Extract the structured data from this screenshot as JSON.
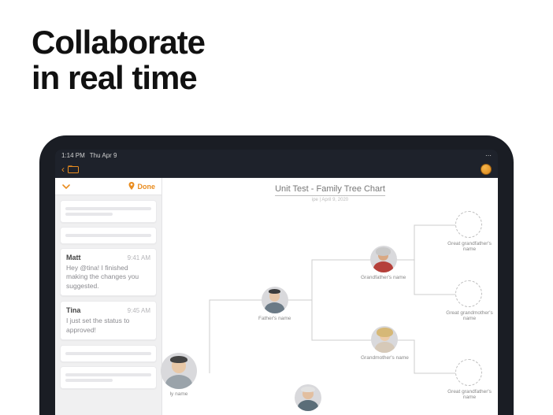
{
  "hero": {
    "line1": "Collaborate",
    "line2": "in real time"
  },
  "statusbar": {
    "time": "1:14 PM",
    "date": "Thu Apr 9"
  },
  "appbar": {},
  "panel": {
    "done": "Done",
    "messages": [
      {
        "name": "Matt",
        "time": "9:41 AM",
        "body": "Hey @tina! I finished making the changes you suggested."
      },
      {
        "name": "Tina",
        "time": "9:45 AM",
        "body": "I just set the status to approved!"
      }
    ]
  },
  "doc": {
    "title": "Unit Test - Family Tree Chart",
    "subtitle": "ipe  |  April 9, 2020"
  },
  "tree": {
    "me": "ly name",
    "father": "Father's name",
    "grandfather": "Grandfather's name",
    "grandmother": "Grandmother's name",
    "great_gf": "Great grandfather's name",
    "great_gm": "Great grandmother's name",
    "great_gf2": "Great grandfather's name"
  }
}
